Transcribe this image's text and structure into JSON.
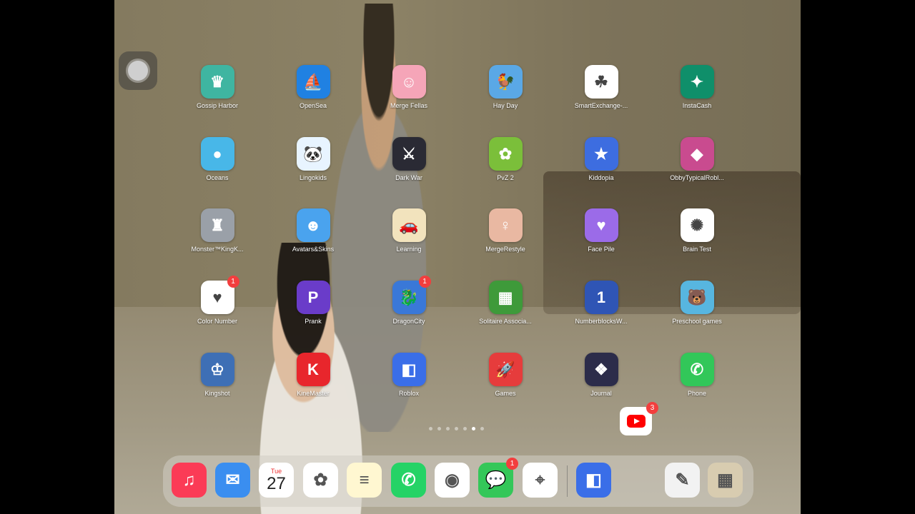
{
  "apps": [
    {
      "name": "Gossip Harbor",
      "icon": "gossip-harbor-icon",
      "bg": "#3fb5a1",
      "glyph": "♛"
    },
    {
      "name": "OpenSea",
      "icon": "opensea-icon",
      "bg": "#2081e2",
      "glyph": "⛵"
    },
    {
      "name": "Merge Fellas",
      "icon": "merge-fellas-icon",
      "bg": "#f5a5b8",
      "glyph": "☺"
    },
    {
      "name": "Hay Day",
      "icon": "hay-day-icon",
      "bg": "#5aa8e6",
      "glyph": "🐓"
    },
    {
      "name": "SmartExchange-...",
      "icon": "clover-icon",
      "bg": "#ffffff",
      "glyph": "☘"
    },
    {
      "name": "InstaCash",
      "icon": "instacash-icon",
      "bg": "#0f8f6a",
      "glyph": "✦"
    },
    {
      "name": "Oceans",
      "icon": "pufferfish-icon",
      "bg": "#48b7e8",
      "glyph": "●"
    },
    {
      "name": "Lingokids",
      "icon": "lingokids-icon",
      "bg": "#e8f4ff",
      "glyph": "🐼"
    },
    {
      "name": "Dark War",
      "icon": "dark-war-icon",
      "bg": "#2a2a34",
      "glyph": "⚔"
    },
    {
      "name": "PvZ 2",
      "icon": "pvz-icon",
      "bg": "#7bbf3a",
      "glyph": "✿"
    },
    {
      "name": "Kiddopia",
      "icon": "kiddopia-icon",
      "bg": "#3d6de0",
      "glyph": "★"
    },
    {
      "name": "ObbyTypicalRobl...",
      "icon": "obby-icon",
      "bg": "#c94b8f",
      "glyph": "◆"
    },
    {
      "name": "Monster™KingK...",
      "icon": "monster-king-icon",
      "bg": "#9aa0a8",
      "glyph": "♜"
    },
    {
      "name": "Avatars&Skins",
      "icon": "avatars-skins-icon",
      "bg": "#4aa3ee",
      "glyph": "☻"
    },
    {
      "name": "Learning",
      "icon": "learning-icon",
      "bg": "#f2e3bd",
      "glyph": "🚗"
    },
    {
      "name": "MergeRestyle",
      "icon": "merge-restyle-icon",
      "bg": "#e9b8a2",
      "glyph": "♀"
    },
    {
      "name": "Face Pile",
      "icon": "face-pile-icon",
      "bg": "#9b6be8",
      "glyph": "♥"
    },
    {
      "name": "Brain Test",
      "icon": "brain-test-icon",
      "bg": "#ffffff",
      "glyph": "✺"
    },
    {
      "name": "Color Number",
      "icon": "color-heart-icon",
      "bg": "#ffffff",
      "glyph": "♥",
      "badge": "1"
    },
    {
      "name": "Prank",
      "icon": "prank-icon",
      "bg": "#6a3cc9",
      "glyph": "P"
    },
    {
      "name": "DragonCity",
      "icon": "dragon-icon",
      "bg": "#3a78d8",
      "glyph": "🐉",
      "badge": "1"
    },
    {
      "name": "Solitaire Associa...",
      "icon": "solitaire-icon",
      "bg": "#3e9a3a",
      "glyph": "▦"
    },
    {
      "name": "NumberblocksW...",
      "icon": "numberblocks-icon",
      "bg": "#2f55b5",
      "glyph": "1"
    },
    {
      "name": "Preschool games",
      "icon": "preschool-icon",
      "bg": "#57b6e0",
      "glyph": "🐻"
    },
    {
      "name": "Kingshot",
      "icon": "kingshot-icon",
      "bg": "#3e6fb5",
      "glyph": "♔"
    },
    {
      "name": "KineMaster",
      "icon": "kinemaster-icon",
      "bg": "#e8262c",
      "glyph": "K"
    },
    {
      "name": "Roblox",
      "icon": "roblox-icon",
      "bg": "#3a6ee8",
      "glyph": "◧"
    },
    {
      "name": "Games",
      "icon": "rocket-icon",
      "bg": "#e63c3c",
      "glyph": "🚀"
    },
    {
      "name": "Journal",
      "icon": "journal-icon",
      "bg": "#2c2c4a",
      "glyph": "❖"
    },
    {
      "name": "Phone",
      "icon": "phone-icon",
      "bg": "#32c759",
      "glyph": "✆"
    }
  ],
  "widget": {
    "icon": "youtube-icon",
    "badge": "3"
  },
  "page_dots": {
    "count": 7,
    "active": 5
  },
  "dock": [
    {
      "icon": "music-icon",
      "bg": "#fb3b56",
      "glyph": "♫"
    },
    {
      "icon": "mail-icon",
      "bg": "#3a8ef0",
      "glyph": "✉"
    },
    {
      "icon": "calendar-icon",
      "bg": "#ffffff",
      "glyph": "",
      "day": "Tue",
      "date": "27"
    },
    {
      "icon": "photos-icon",
      "bg": "#ffffff",
      "glyph": "✿"
    },
    {
      "icon": "notes-icon",
      "bg": "#fff7d1",
      "glyph": "≡"
    },
    {
      "icon": "whatsapp-icon",
      "bg": "#25d366",
      "glyph": "✆"
    },
    {
      "icon": "chrome-icon",
      "bg": "#ffffff",
      "glyph": "◉"
    },
    {
      "icon": "messages-icon",
      "bg": "#34c759",
      "glyph": "💬",
      "badge": "1"
    },
    {
      "icon": "safari-icon",
      "bg": "#ffffff",
      "glyph": "⌖"
    },
    {
      "icon": "roblox-icon",
      "bg": "#3a6ee8",
      "glyph": "◧"
    },
    {
      "icon": "brush-app-icon",
      "bg": "#f2f2f2",
      "glyph": "✎"
    },
    {
      "icon": "app-library-icon",
      "bg": "#d8ccb0",
      "glyph": "▦"
    }
  ],
  "colors": {
    "badge": "#f33e3e"
  }
}
